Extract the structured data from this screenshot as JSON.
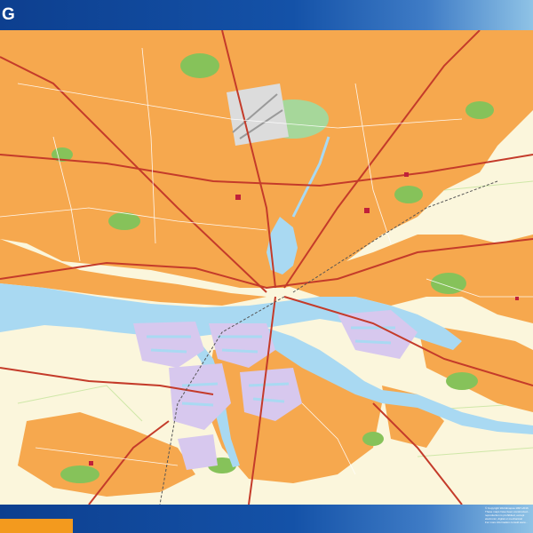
{
  "header": {
    "title": "G"
  },
  "map": {
    "colors": {
      "land": "#fbf6dc",
      "urban": "#f6a84e",
      "road_major": "#c43b2a",
      "road_minor": "#ffffff",
      "water": "#a9d9f2",
      "port": "#d7c8ee",
      "park": "#86c25a",
      "airport": "#dcdcdc"
    },
    "features": [
      "urban-area",
      "river-elbe",
      "alster-lake",
      "harbor-docks",
      "airport",
      "parks",
      "roads",
      "rail"
    ]
  },
  "footer": {
    "copyright_lines": [
      "© Copyright Worldmapsa 1997-2016",
      "These maps have been constructed...",
      "reproduction is prohibited, except",
      "electronic, digital or mechanical",
      "For more information consult www..."
    ],
    "colors": {
      "band": "#1452a8",
      "tab": "#f39a1e"
    }
  }
}
